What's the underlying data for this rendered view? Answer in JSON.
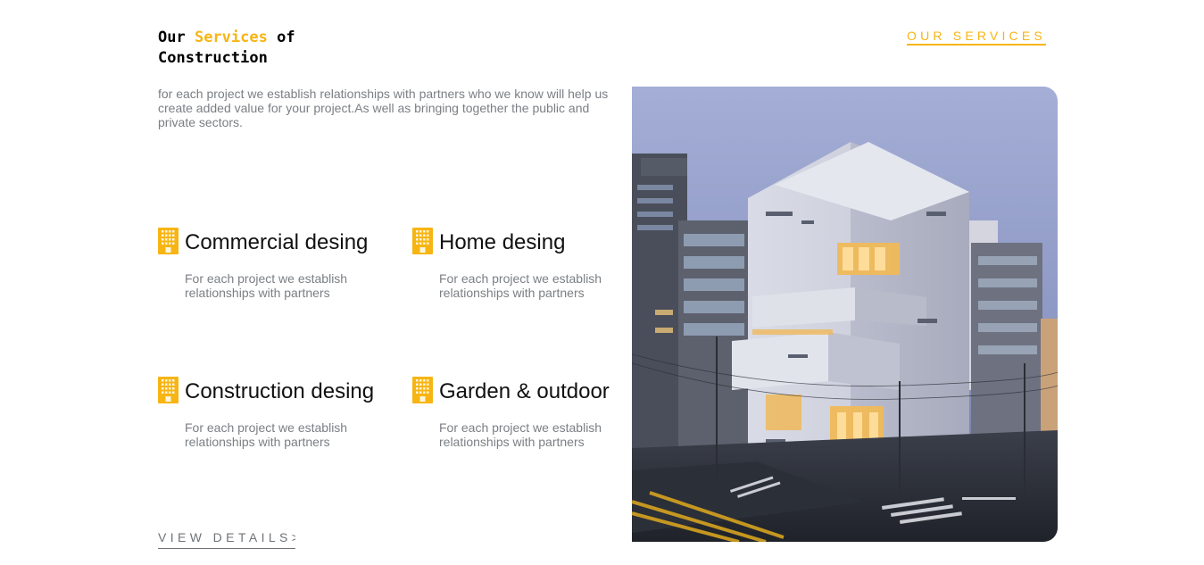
{
  "header": {
    "title_part1": "Our ",
    "title_accent": "Services",
    "title_part2": " of",
    "title_line2": "Construction",
    "top_link": "OUR SERVICES"
  },
  "intro": "for each project we establish relationships with partners who we know will help us create added value for your project.As well as bringing together the public and private sectors.",
  "services": [
    {
      "icon": "building-icon",
      "title": "Commercial desing",
      "desc": "For each project we establish relationships with partners"
    },
    {
      "icon": "building-icon",
      "title": "Home desing",
      "desc": "For each project we establish relationships with partners"
    },
    {
      "icon": "building-icon",
      "title": "Construction desing",
      "desc": "For each project we establish relationships with partners"
    },
    {
      "icon": "building-icon",
      "title": "Garden & outdoor",
      "desc": "For each project we establish relationships with partners"
    }
  ],
  "view_details": "VIEW DETAILS>",
  "colors": {
    "accent": "#f7b514",
    "muted_text": "#7b7f84",
    "heading_text": "#000000"
  }
}
